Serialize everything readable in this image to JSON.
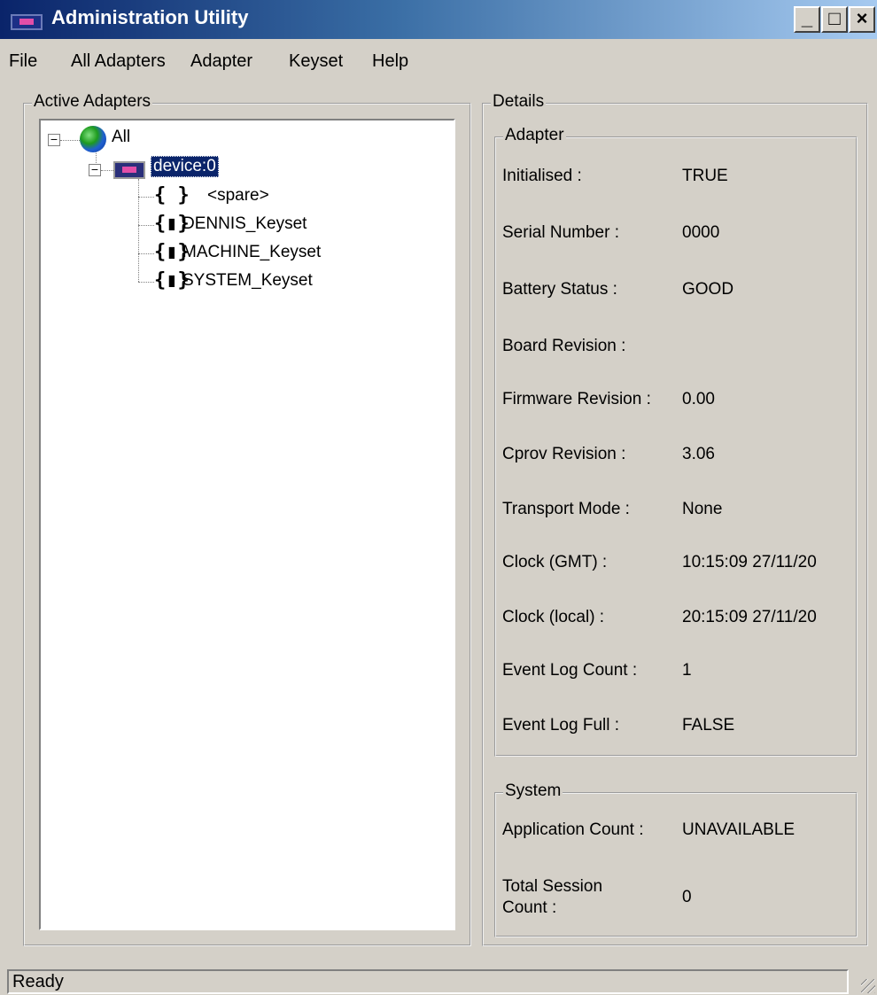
{
  "window": {
    "title": "Administration Utility",
    "controls": [
      "_",
      "□",
      "×"
    ]
  },
  "menu": [
    "File",
    "All Adapters",
    "Adapter",
    "Keyset",
    "Help"
  ],
  "active_adapters": {
    "label": "Active Adapters",
    "tree": {
      "root": "All",
      "device": "device:0",
      "keysets": [
        {
          "icon": "{ }",
          "label": "<spare>"
        },
        {
          "icon": "{▮}",
          "label": "DENNIS_Keyset"
        },
        {
          "icon": "{▮}",
          "label": "MACHINE_Keyset"
        },
        {
          "icon": "{▮}",
          "label": "SYSTEM_Keyset"
        }
      ]
    }
  },
  "details": {
    "label": "Details",
    "adapter": {
      "label": "Adapter",
      "rows": [
        {
          "label": "Initialised :",
          "value": "TRUE"
        },
        {
          "label": "Serial Number :",
          "value": "0000"
        },
        {
          "label": "Battery Status :",
          "value": "GOOD"
        },
        {
          "label": "Board Revision :",
          "value": ""
        },
        {
          "label": "Firmware Revision :",
          "value": "0.00"
        },
        {
          "label": "Cprov Revision :",
          "value": "3.06"
        },
        {
          "label": "Transport Mode :",
          "value": "None"
        },
        {
          "label": "Clock (GMT) :",
          "value": "10:15:09 27/11/20"
        },
        {
          "label": "Clock (local) :",
          "value": "20:15:09 27/11/20"
        },
        {
          "label": "Event Log Count :",
          "value": "1"
        },
        {
          "label": "Event Log Full :",
          "value": "FALSE"
        }
      ]
    },
    "system": {
      "label": "System",
      "rows": [
        {
          "label": "Application Count :",
          "value": "UNAVAILABLE"
        },
        {
          "label_line1": "Total Session",
          "label_line2": "Count :",
          "value": "0"
        }
      ]
    }
  },
  "status": "Ready"
}
